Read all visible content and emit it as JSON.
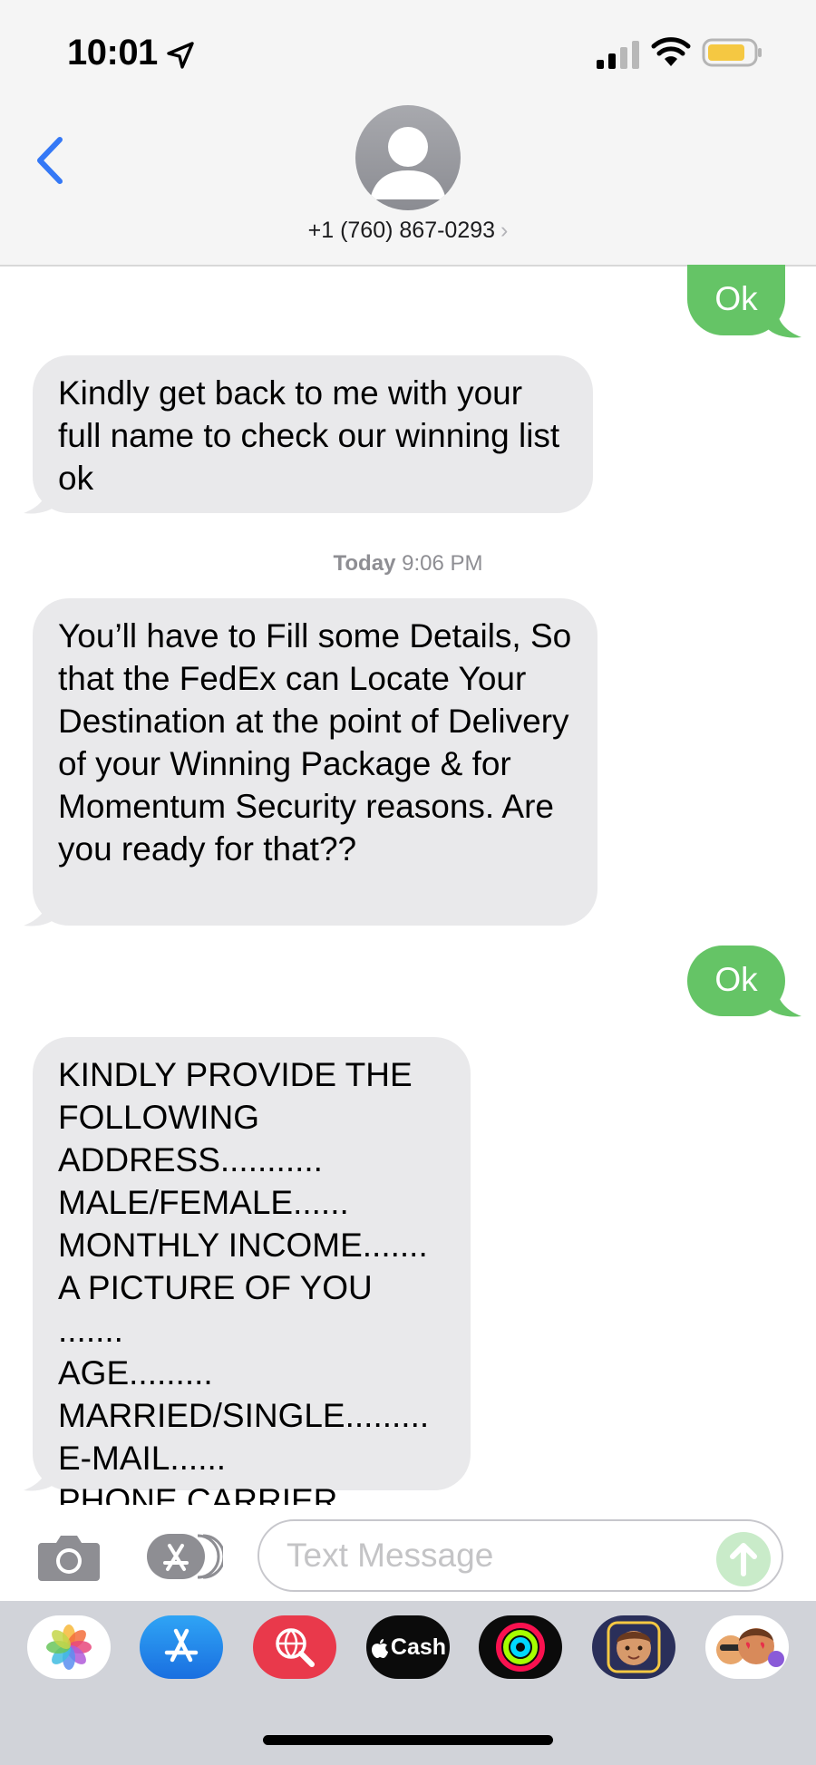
{
  "status_bar": {
    "time": "10:01",
    "location_icon": "location-arrow-icon",
    "signal_icon": "cellular-signal-icon",
    "wifi_icon": "wifi-icon",
    "battery_icon": "battery-low-power-icon"
  },
  "header": {
    "back_icon": "chevron-left-icon",
    "avatar_icon": "person-silhouette-icon",
    "contact": "+1 (760) 867-0293",
    "contact_chevron": "›"
  },
  "messages": [
    {
      "direction": "outgoing",
      "text": "Ok"
    },
    {
      "direction": "incoming",
      "text": "Kindly get back to me with your full name to check our winning list ok"
    },
    {
      "direction": "incoming",
      "text": "You’ll have to Fill some Details, So that the FedEx can Locate Your Destination at the point of Delivery of your Winning Package & for Momentum Security reasons. Are you ready for that??"
    },
    {
      "direction": "outgoing",
      "text": "Ok"
    },
    {
      "direction": "incoming",
      "text": "KINDLY PROVIDE THE\nFOLLOWING\nADDRESS...........\nMALE/FEMALE......\nMONTHLY INCOME.......\nA PICTURE OF YOU .......\nAGE.........\nMARRIED/SINGLE.........\nE-MAIL......\nPHONE CARRIER........"
    }
  ],
  "timestamp": {
    "day": "Today",
    "time": "9:06 PM"
  },
  "compose": {
    "placeholder": "Text Message",
    "value": "",
    "camera_icon": "camera-icon",
    "apps_icon": "app-store-icon",
    "send_icon": "arrow-up-icon"
  },
  "app_drawer": {
    "apps": [
      {
        "name": "photos-icon"
      },
      {
        "name": "app-store-icon"
      },
      {
        "name": "images-search-icon"
      },
      {
        "name": "apple-cash-icon",
        "label": "Cash"
      },
      {
        "name": "fitness-rings-icon"
      },
      {
        "name": "memoji-icon"
      },
      {
        "name": "animoji-stickers-icon"
      }
    ]
  },
  "colors": {
    "outgoing_bubble": "#65c466",
    "incoming_bubble": "#e9e9eb",
    "accent": "#3478f6",
    "header_background": "#f5f5f5"
  }
}
